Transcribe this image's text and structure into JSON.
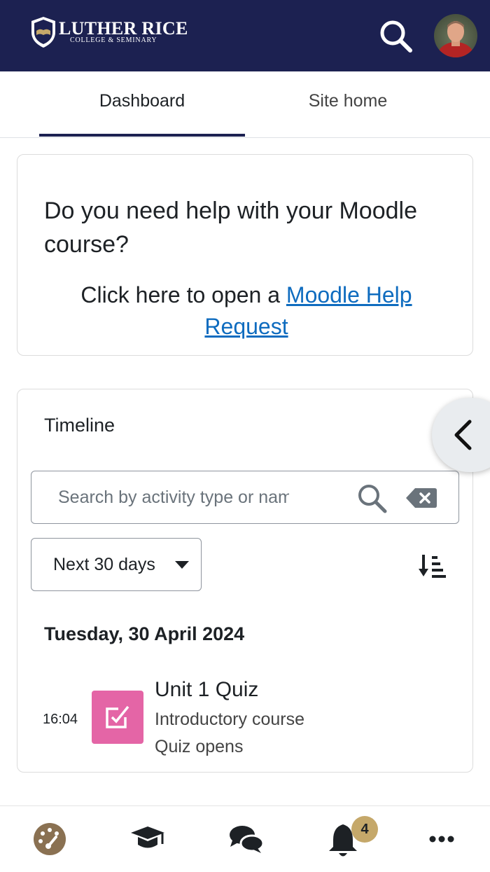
{
  "header": {
    "logo_title": "LUTHER RICE",
    "logo_subtitle": "COLLEGE & SEMINARY",
    "brand_color": "#1c2151"
  },
  "tabs": [
    {
      "label": "Dashboard",
      "active": true
    },
    {
      "label": "Site home",
      "active": false
    }
  ],
  "help_card": {
    "title": "Do you need help with your Moodle course?",
    "body_prefix": "Click here to open a ",
    "link_text": "Moodle Help Request"
  },
  "timeline": {
    "title": "Timeline",
    "search_placeholder": "Search by activity type or name",
    "filter_label": "Next 30 days",
    "date_heading": "Tuesday, 30 April 2024",
    "events": [
      {
        "time": "16:04",
        "title": "Unit 1 Quiz",
        "course": "Introductory course",
        "action": "Quiz opens",
        "icon": "quiz-icon",
        "icon_color": "#e2589f"
      }
    ]
  },
  "bottom_nav": {
    "items": [
      "dashboard-icon",
      "courses-icon",
      "messages-icon",
      "notifications-icon",
      "more-icon"
    ],
    "notification_count": "4",
    "badge_color": "#c5a86a"
  }
}
